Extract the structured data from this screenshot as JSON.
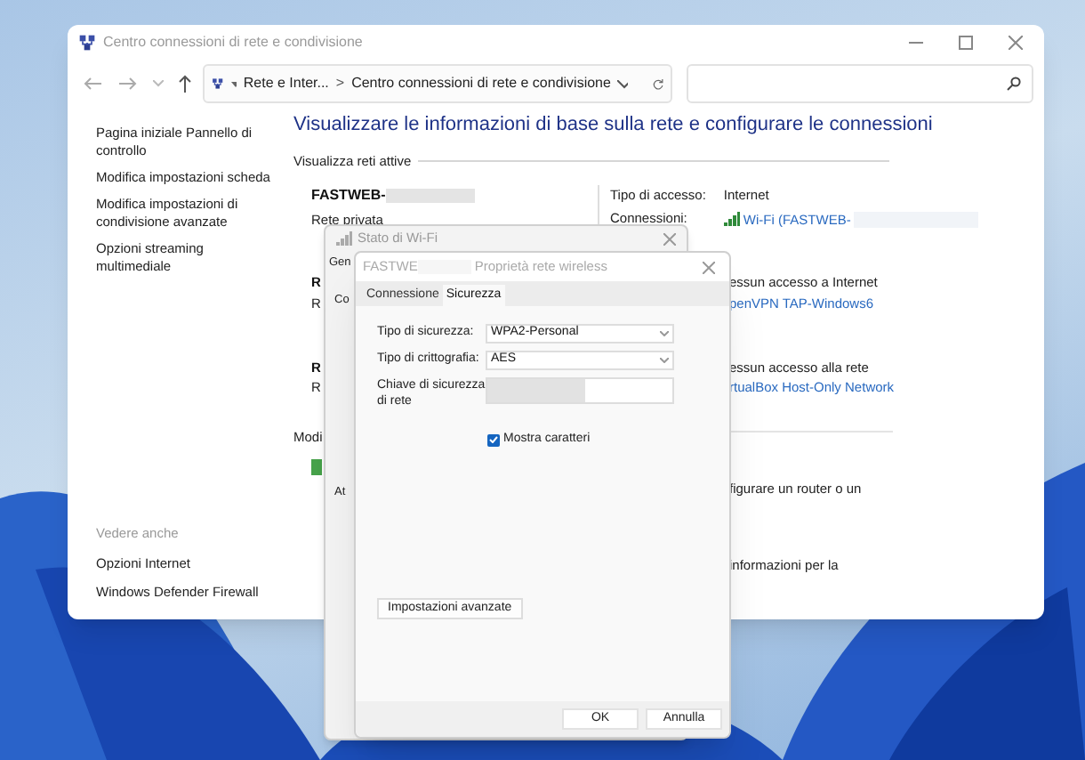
{
  "window": {
    "title": "Centro connessioni di rete e condivisione"
  },
  "address_bar": {
    "breadcrumbs": [
      "Rete e Inter...",
      "Centro connessioni di rete e condivisione"
    ],
    "separator": ">"
  },
  "sidebar": {
    "items": [
      "Pagina iniziale Pannello di controllo",
      "Modifica impostazioni scheda",
      "Modifica impostazioni di condivisione avanzate",
      "Opzioni streaming multimediale"
    ],
    "see_also_title": "Vedere anche",
    "see_also": [
      "Opzioni Internet",
      "Windows Defender Firewall"
    ]
  },
  "main": {
    "heading": "Visualizzare le informazioni di base sulla rete e configurare le connessioni",
    "section_title": "Visualizza reti attive",
    "network": {
      "name": "FASTWEB-",
      "type": "Rete privata",
      "access_label": "Tipo di accesso:",
      "access_value": "Internet",
      "connections_label": "Connessioni:",
      "connection_link": "Wi-Fi (FASTWEB-"
    },
    "partly_hidden": [
      {
        "text": "R",
        "kind": "bold"
      },
      {
        "text": "R",
        "kind": "plain"
      },
      {
        "text": "R",
        "kind": "bold"
      },
      {
        "text": "R",
        "kind": "plain"
      },
      {
        "text": "Modi",
        "kind": "plain"
      },
      {
        "text": "essun accesso a Internet",
        "kind": "plain"
      },
      {
        "text": "penVPN TAP-Windows6",
        "kind": "link"
      },
      {
        "text": "essun accesso alla rete",
        "kind": "plain"
      },
      {
        "text": "rtualBox Host-Only Network",
        "kind": "link"
      },
      {
        "text": "figurare un router o un",
        "kind": "plain"
      },
      {
        "text": "informazioni per la",
        "kind": "plain"
      }
    ]
  },
  "wifi_status": {
    "title": "Stato di Wi-Fi",
    "fragments": [
      "Gen",
      "Co",
      "At"
    ]
  },
  "dialog": {
    "title": "FASTWE",
    "subtitle": "Proprietà rete wireless",
    "tabs": [
      {
        "label": "Connessione",
        "selected": false
      },
      {
        "label": "Sicurezza",
        "selected": true
      }
    ],
    "fields": [
      {
        "label": "Tipo di sicurezza:",
        "value": "WPA2-Personal",
        "kind": "select"
      },
      {
        "label": "Tipo di crittografia:",
        "value": "AES",
        "kind": "select"
      },
      {
        "label": "Chiave di sicurezza di rete",
        "kind": "password"
      }
    ],
    "show_characters": {
      "label": "Mostra caratteri",
      "checked": true
    },
    "advanced_button": "Impostazioni avanzate",
    "buttons": [
      "OK",
      "Annulla"
    ]
  }
}
